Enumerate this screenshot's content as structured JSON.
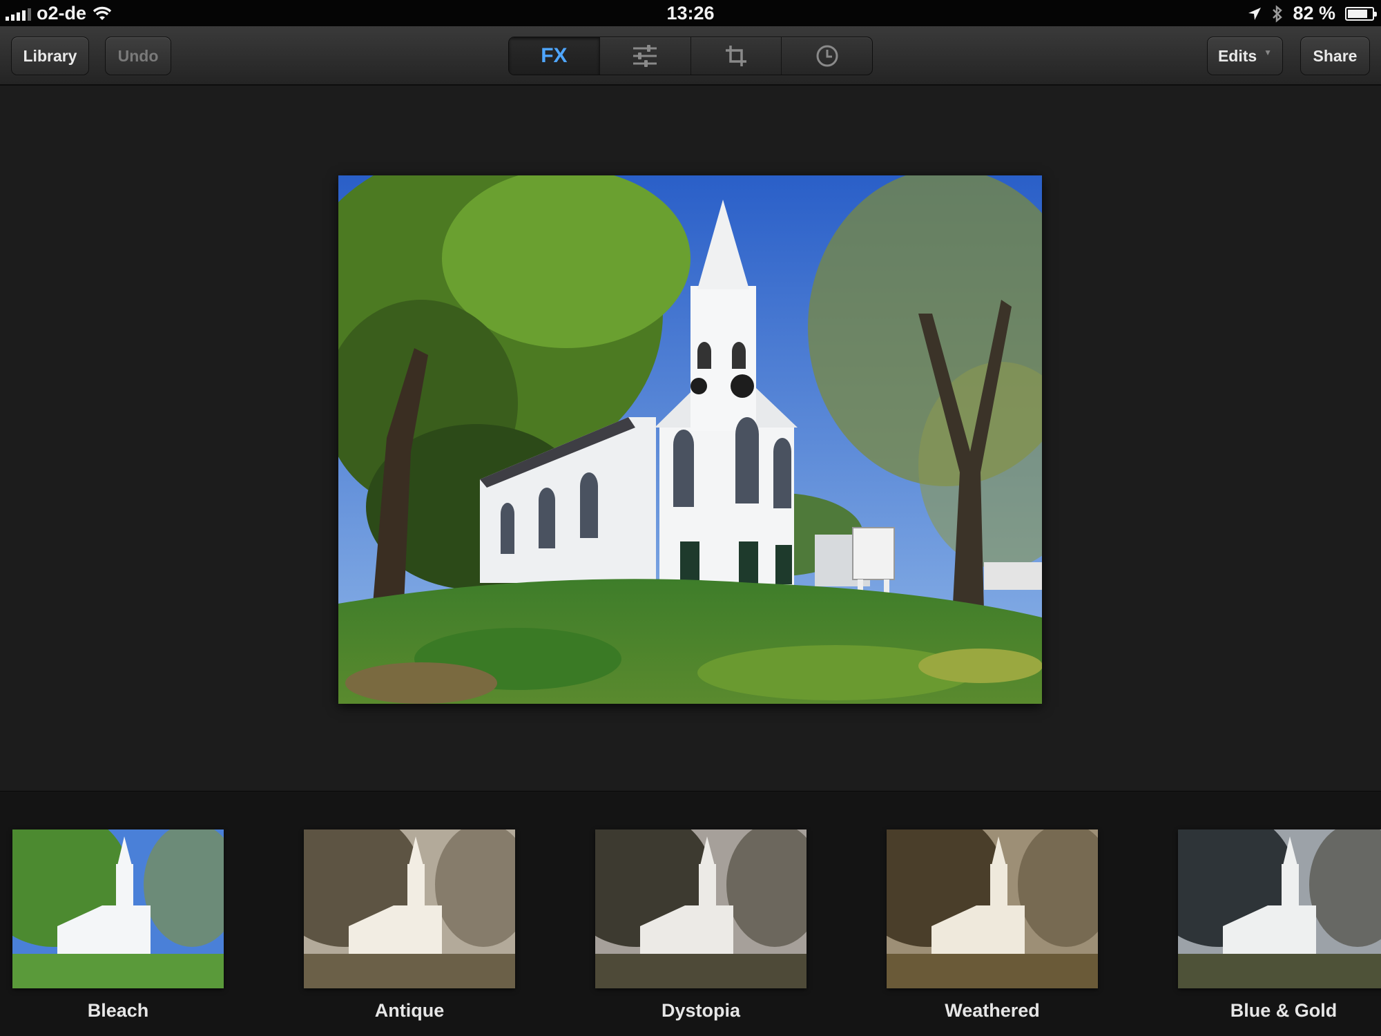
{
  "status_bar": {
    "carrier": "o2-de",
    "time": "13:26",
    "battery_percent": "82 %",
    "battery_level": 0.82,
    "icons": [
      "signal-bars-icon",
      "wifi-icon",
      "location-arrow-icon",
      "bluetooth-icon",
      "battery-icon"
    ]
  },
  "toolbar": {
    "library_label": "Library",
    "undo_label": "Undo",
    "edits_label": "Edits",
    "share_label": "Share",
    "segments": {
      "fx_label": "FX",
      "adjust_icon": "sliders-icon",
      "crop_icon": "crop-icon",
      "history_icon": "clock-icon"
    },
    "active_segment": "FX",
    "accent_color": "#4fa6ff"
  },
  "filters": [
    {
      "label": "Bleach"
    },
    {
      "label": "Antique"
    },
    {
      "label": "Dystopia"
    },
    {
      "label": "Weathered"
    },
    {
      "label": "Blue & Gold"
    }
  ]
}
